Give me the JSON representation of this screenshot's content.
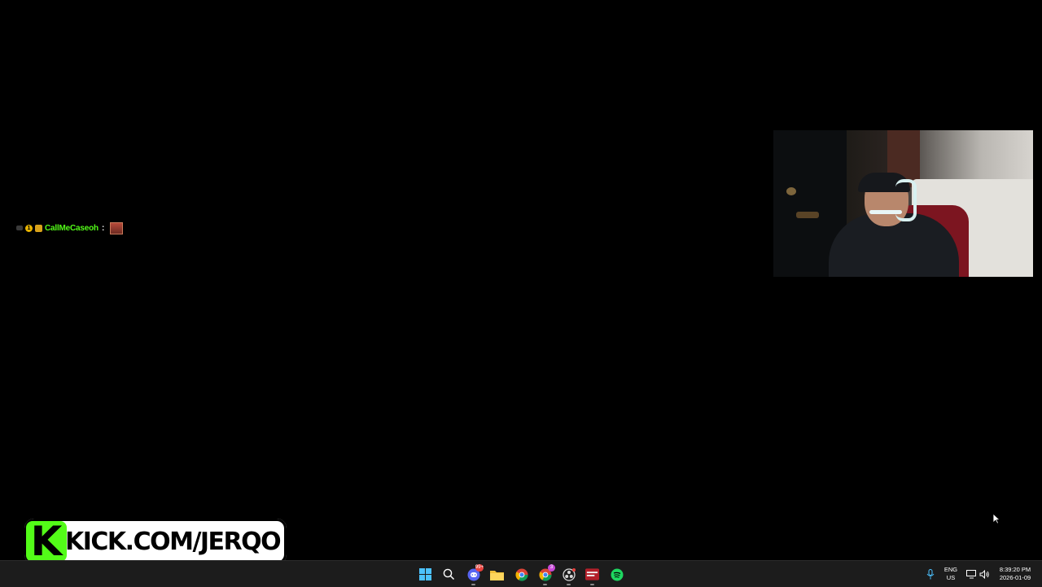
{
  "chat": {
    "username": "CallMeCaseoh",
    "separator": ":",
    "badge_number": "1"
  },
  "kick_banner": {
    "logo_letter": "K",
    "text": "KICK.COM/JERQO"
  },
  "taskbar": {
    "apps": [
      {
        "name": "Start",
        "icon": "windows-icon"
      },
      {
        "name": "Search",
        "icon": "search-icon"
      },
      {
        "name": "Discord",
        "icon": "discord-icon",
        "badge": "99+"
      },
      {
        "name": "File Explorer",
        "icon": "folder-icon"
      },
      {
        "name": "Chrome",
        "icon": "chrome-icon"
      },
      {
        "name": "Chrome Canary",
        "icon": "chrome-alt-icon",
        "badge": "3"
      },
      {
        "name": "OBS",
        "icon": "obs-icon"
      },
      {
        "name": "Streamer App",
        "icon": "app-icon"
      },
      {
        "name": "Spotify",
        "icon": "spotify-icon"
      }
    ],
    "language_line1": "ENG",
    "language_line2": "US",
    "time": "8:39:20 PM",
    "date": "2026-01-09"
  },
  "colors": {
    "kick_green": "#53fc18",
    "taskbar_bg": "#1c1c1c",
    "windows_blue": "#4cc2ff"
  }
}
